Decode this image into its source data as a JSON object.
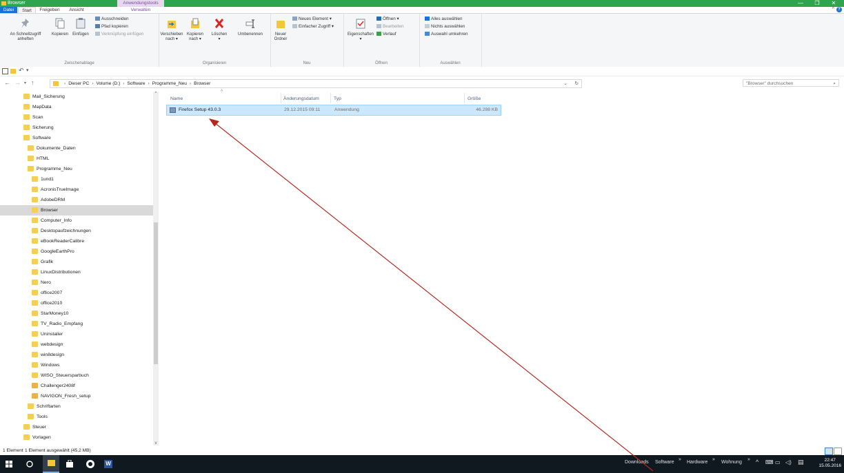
{
  "window": {
    "title": "Browser",
    "context_tab": "Anwendungstools",
    "controls": [
      "—",
      "❐",
      "✕"
    ]
  },
  "ribbon_tabs": [
    "Datei",
    "Start",
    "Freigeben",
    "Ansicht",
    "Verwalten"
  ],
  "ribbon": {
    "zwischenablage": {
      "label": "Zwischenablage",
      "pin_line1": "An Schnellzugriff",
      "pin_line2": "anheften",
      "kopieren": "Kopieren",
      "einfuegen": "Einfügen",
      "ausschneiden": "Ausschneiden",
      "pfad_kopieren": "Pfad kopieren",
      "verknuepfung": "Verknüpfung einfügen"
    },
    "organisieren": {
      "label": "Organisieren",
      "verschieben_l1": "Verschieben",
      "verschieben_l2": "nach ▾",
      "kopieren_l1": "Kopieren",
      "kopieren_l2": "nach ▾",
      "loeschen_l1": "Löschen",
      "loeschen_l2": "▾",
      "umbenennen": "Umbenennen"
    },
    "neu": {
      "label": "Neu",
      "ordner_l1": "Neuer",
      "ordner_l2": "Ordner",
      "neues_element": "Neues Element ▾",
      "einfacher_zugriff": "Einfacher Zugriff ▾"
    },
    "oeffnen": {
      "label": "Öffnen",
      "eigenschaften_l1": "Eigenschaften",
      "eigenschaften_l2": "▾",
      "oeffnen": "Öffnen ▾",
      "bearbeiten": "Bearbeiten",
      "verlauf": "Verlauf"
    },
    "auswaehlen": {
      "label": "Auswählen",
      "alles": "Alles auswählen",
      "nichts": "Nichts auswählen",
      "umkehren": "Auswahl umkehren"
    }
  },
  "address": {
    "crumbs": [
      "Dieser PC",
      "Volume (D:)",
      "Software",
      "Programme_Neu",
      "Browser"
    ],
    "search_placeholder": "\"Browser\" durchsuchen"
  },
  "nav_tree": [
    {
      "label": "Mail_Sicherung",
      "level": 0
    },
    {
      "label": "MapData",
      "level": 0
    },
    {
      "label": "Scan",
      "level": 0
    },
    {
      "label": "Sicherung",
      "level": 0
    },
    {
      "label": "Software",
      "level": 0
    },
    {
      "label": "Dokumente_Daten",
      "level": 1
    },
    {
      "label": "HTML",
      "level": 1
    },
    {
      "label": "Programme_Neu",
      "level": 1
    },
    {
      "label": "1und1",
      "level": 2
    },
    {
      "label": "AcronisTrueImage",
      "level": 2
    },
    {
      "label": "AdobeDRM",
      "level": 2
    },
    {
      "label": "Browser",
      "level": 2,
      "selected": true
    },
    {
      "label": "Computer_Info",
      "level": 2
    },
    {
      "label": "Desktopaufzeichnungen",
      "level": 2
    },
    {
      "label": "eBookReaderCalibre",
      "level": 2
    },
    {
      "label": "GoogleEarthPro",
      "level": 2
    },
    {
      "label": "Grafik",
      "level": 2
    },
    {
      "label": "LinuxDistributionen",
      "level": 2
    },
    {
      "label": "Nero",
      "level": 2
    },
    {
      "label": "office2007",
      "level": 2
    },
    {
      "label": "office2010",
      "level": 2
    },
    {
      "label": "StarMoney10",
      "level": 2
    },
    {
      "label": "TV_Radio_Empfang",
      "level": 2
    },
    {
      "label": "Uninstaller",
      "level": 2
    },
    {
      "label": "webdesign",
      "level": 2
    },
    {
      "label": "win8design",
      "level": 2
    },
    {
      "label": "Windows",
      "level": 2
    },
    {
      "label": "WISO_Steuersparbuch",
      "level": 2
    },
    {
      "label": "Challenger2408f",
      "level": 2,
      "exe": true
    },
    {
      "label": "NAVIGON_Fresh_setup",
      "level": 2,
      "exe": true
    },
    {
      "label": "Schriftarten",
      "level": 1
    },
    {
      "label": "Tools",
      "level": 1
    },
    {
      "label": "Steuer",
      "level": 0
    },
    {
      "label": "Vorlagen",
      "level": 0
    }
  ],
  "columns": {
    "name": "Name",
    "date": "Änderungsdatum",
    "type": "Typ",
    "size": "Größe"
  },
  "files": [
    {
      "name": "Firefox Setup 43.0.3",
      "date": "29.12.2015 09:11",
      "type": "Anwendung",
      "size": "46.298 KB"
    }
  ],
  "status": {
    "count": "1 Element",
    "selected": "1 Element ausgewählt (45,2 MB)"
  },
  "taskbar": {
    "toolbar_links": [
      "Downloads",
      "Software",
      "»",
      "Hardware",
      "»",
      "Wohnung",
      "»"
    ],
    "time": "22:47",
    "date": "15.05.2016"
  },
  "colors": {
    "titlebar": "#2ea44f",
    "accent": "#1a73d4",
    "selection": "#cce8ff",
    "annotation_arrow": "#b22a1f"
  }
}
